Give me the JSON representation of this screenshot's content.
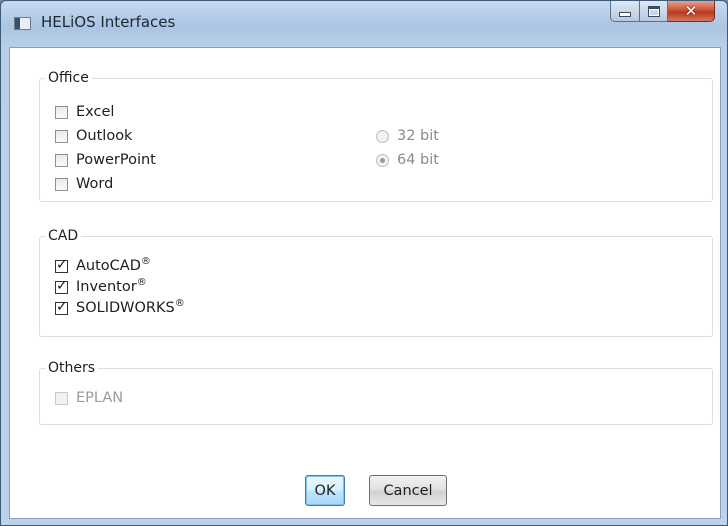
{
  "window": {
    "title": "HELiOS Interfaces",
    "buttons": {
      "minimize": "minimize-icon",
      "maximize": "maximize-icon",
      "close": "close-icon"
    }
  },
  "office": {
    "header": "Office",
    "items": [
      {
        "label": "Excel",
        "checked": false
      },
      {
        "label": "Outlook",
        "checked": false
      },
      {
        "label": "PowerPoint",
        "checked": false
      },
      {
        "label": "Word",
        "checked": false
      }
    ],
    "bitness": [
      {
        "label": "32 bit",
        "selected": false
      },
      {
        "label": "64 bit",
        "selected": true
      }
    ]
  },
  "cad": {
    "header": "CAD",
    "items": [
      {
        "label": "AutoCAD",
        "mark": "®",
        "checked": true
      },
      {
        "label": "Inventor",
        "mark": "®",
        "checked": true
      },
      {
        "label": "SOLIDWORKS",
        "mark": "®",
        "checked": true
      }
    ]
  },
  "others": {
    "header": "Others",
    "items": [
      {
        "label": "EPLAN",
        "checked": false,
        "enabled": false
      }
    ]
  },
  "footer": {
    "ok_label": "OK",
    "cancel_label": "Cancel"
  },
  "colors": {
    "accent": "#3c7fb1",
    "title_bar": "#aac4e2",
    "close_button": "#c9553b"
  }
}
